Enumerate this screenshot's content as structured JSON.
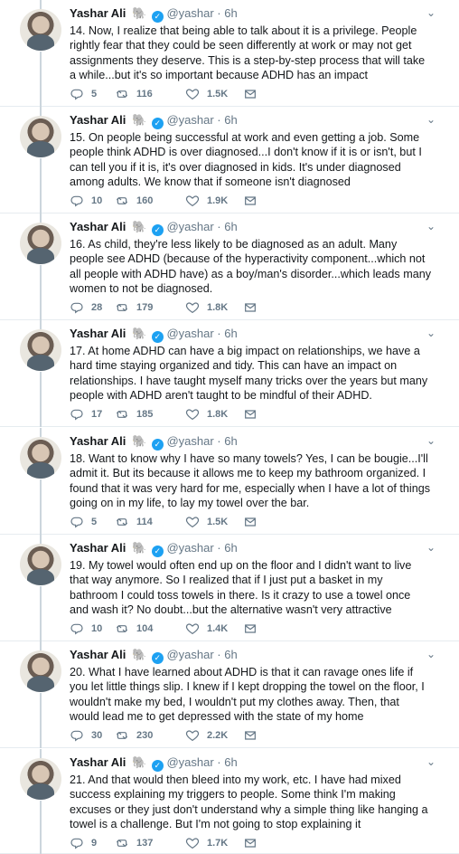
{
  "tweets": [
    {
      "name": "Yashar Ali",
      "handle": "@yashar",
      "dot": "·",
      "time": "6h",
      "text": "14. Now, I realize that being able to talk about it is a privilege. People rightly fear that they could be seen differently at work or may not get assignments they deserve. This is a step-by-step process that will take a while...but it's so important because ADHD has an impact",
      "replies": "5",
      "retweets": "116",
      "likes": "1.5K"
    },
    {
      "name": "Yashar Ali",
      "handle": "@yashar",
      "dot": "·",
      "time": "6h",
      "text": "15. On people being successful at work and even getting a job. Some people think ADHD is over diagnosed...I don't know if it is or isn't, but I can tell you if it is, it's over diagnosed in kids. It's under diagnosed among adults. We know that if someone isn't diagnosed",
      "replies": "10",
      "retweets": "160",
      "likes": "1.9K"
    },
    {
      "name": "Yashar Ali",
      "handle": "@yashar",
      "dot": "·",
      "time": "6h",
      "text": "16. As child, they're less likely to be diagnosed as an adult. Many people see ADHD (because of the hyperactivity component...which not all people with ADHD have) as a boy/man's disorder...which leads many women to not be diagnosed.",
      "replies": "28",
      "retweets": "179",
      "likes": "1.8K"
    },
    {
      "name": "Yashar Ali",
      "handle": "@yashar",
      "dot": "·",
      "time": "6h",
      "text": "17. At home ADHD can have a big impact on relationships, we have a hard time staying organized and tidy. This can have an impact on relationships. I have taught myself many tricks over the years but many people with ADHD aren't taught to be mindful of their ADHD.",
      "replies": "17",
      "retweets": "185",
      "likes": "1.8K"
    },
    {
      "name": "Yashar Ali",
      "handle": "@yashar",
      "dot": "·",
      "time": "6h",
      "text": "18. Want to know why I have so many towels? Yes, I can be bougie...I'll admit it. But its because it allows me to keep my bathroom organized. I found that it was very hard for me, especially when I have a lot of things going on in my life, to lay my towel over the bar.",
      "replies": "5",
      "retweets": "114",
      "likes": "1.5K"
    },
    {
      "name": "Yashar Ali",
      "handle": "@yashar",
      "dot": "·",
      "time": "6h",
      "text": "19. My towel would often end up on the floor and I didn't want to live that way anymore. So I realized that if I just put a basket in my bathroom I could toss towels in there. Is it crazy to use a towel once and wash it? No doubt...but the alternative wasn't very attractive",
      "replies": "10",
      "retweets": "104",
      "likes": "1.4K"
    },
    {
      "name": "Yashar Ali",
      "handle": "@yashar",
      "dot": "·",
      "time": "6h",
      "text": "20. What I have learned about ADHD is that it can ravage ones life if you let little things slip. I knew if I kept dropping the towel on the floor, I wouldn't make my bed, I wouldn't put my clothes away. Then, that would lead me to get depressed with the state of my home",
      "replies": "30",
      "retweets": "230",
      "likes": "2.2K"
    },
    {
      "name": "Yashar Ali",
      "handle": "@yashar",
      "dot": "·",
      "time": "6h",
      "text": "21. And that would then bleed into my work, etc. I have had mixed success explaining my triggers to people. Some think I'm making excuses or they just don't understand why a simple thing like hanging a towel is a challenge. But I'm not going to stop explaining it",
      "replies": "9",
      "retweets": "137",
      "likes": "1.7K"
    }
  ],
  "icons": {
    "caret": "chevron-down-icon",
    "elephant": "elephant-emoji-icon",
    "verified": "verified-badge-icon",
    "reply": "reply-icon",
    "retweet": "retweet-icon",
    "like": "heart-icon",
    "mail": "direct-message-icon"
  },
  "colors": {
    "accent": "#1da1f2",
    "muted": "#657786",
    "text": "#14171a",
    "divider": "#e6ecf0"
  }
}
